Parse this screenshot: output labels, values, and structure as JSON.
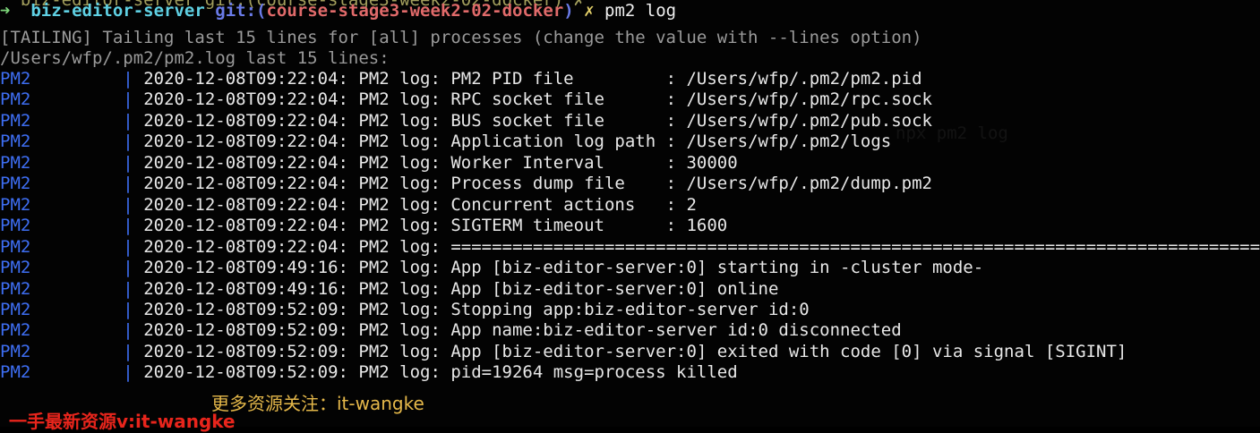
{
  "terminal": {
    "previous_prompt": "  biz-editor-server git:(course-stage3-week2-02-docker) ✗",
    "prompt": {
      "arrow": "➜",
      "directory": "biz-editor-server",
      "git_prefix": "git:(",
      "branch": "course-stage3-week2-02-docker",
      "git_suffix": ")",
      "dirty_marker": "✗",
      "command": "pm2 log"
    },
    "tailing_line": "[TAILING] Tailing last 15 lines for [all] processes (change the value with --lines option)",
    "log_path_line": "/Users/wfp/.pm2/pm2.log last 15 lines:",
    "log_lines": [
      {
        "tag": "PM2",
        "text": "2020-12-08T09:22:04: PM2 log: PM2 PID file         : /Users/wfp/.pm2/pm2.pid"
      },
      {
        "tag": "PM2",
        "text": "2020-12-08T09:22:04: PM2 log: RPC socket file      : /Users/wfp/.pm2/rpc.sock"
      },
      {
        "tag": "PM2",
        "text": "2020-12-08T09:22:04: PM2 log: BUS socket file      : /Users/wfp/.pm2/pub.sock"
      },
      {
        "tag": "PM2",
        "text": "2020-12-08T09:22:04: PM2 log: Application log path : /Users/wfp/.pm2/logs"
      },
      {
        "tag": "PM2",
        "text": "2020-12-08T09:22:04: PM2 log: Worker Interval      : 30000"
      },
      {
        "tag": "PM2",
        "text": "2020-12-08T09:22:04: PM2 log: Process dump file    : /Users/wfp/.pm2/dump.pm2"
      },
      {
        "tag": "PM2",
        "text": "2020-12-08T09:22:04: PM2 log: Concurrent actions   : 2"
      },
      {
        "tag": "PM2",
        "text": "2020-12-08T09:22:04: PM2 log: SIGTERM timeout      : 1600"
      },
      {
        "tag": "PM2",
        "text": "2020-12-08T09:22:04: PM2 log: ==============================================================================="
      },
      {
        "tag": "PM2",
        "text": "2020-12-08T09:49:16: PM2 log: App [biz-editor-server:0] starting in -cluster mode-"
      },
      {
        "tag": "PM2",
        "text": "2020-12-08T09:49:16: PM2 log: App [biz-editor-server:0] online"
      },
      {
        "tag": "PM2",
        "text": "2020-12-08T09:52:09: PM2 log: Stopping app:biz-editor-server id:0"
      },
      {
        "tag": "PM2",
        "text": "2020-12-08T09:52:09: PM2 log: App name:biz-editor-server id:0 disconnected"
      },
      {
        "tag": "PM2",
        "text": "2020-12-08T09:52:09: PM2 log: App [biz-editor-server:0] exited with code [0] via signal [SIGINT]"
      },
      {
        "tag": "PM2",
        "text": "2020-12-08T09:52:09: PM2 log: pid=19264 msg=process killed"
      }
    ],
    "pipe_char": "|"
  },
  "watermarks": {
    "follow_text": "更多资源关注：it-wangke",
    "red_text": "一手最新资源v:it-wangke"
  },
  "colors": {
    "background": "#030303",
    "prompt_arrow": "#7dd67a",
    "directory": "#5fd0e3",
    "git": "#6a7be8",
    "branch": "#e06a6a",
    "dirty": "#e6d26a",
    "pm2_tag": "#3e6ef2",
    "dim_text": "#9a9a9a",
    "watermark_gold": "#e5b84a",
    "watermark_red": "#e8251c"
  }
}
